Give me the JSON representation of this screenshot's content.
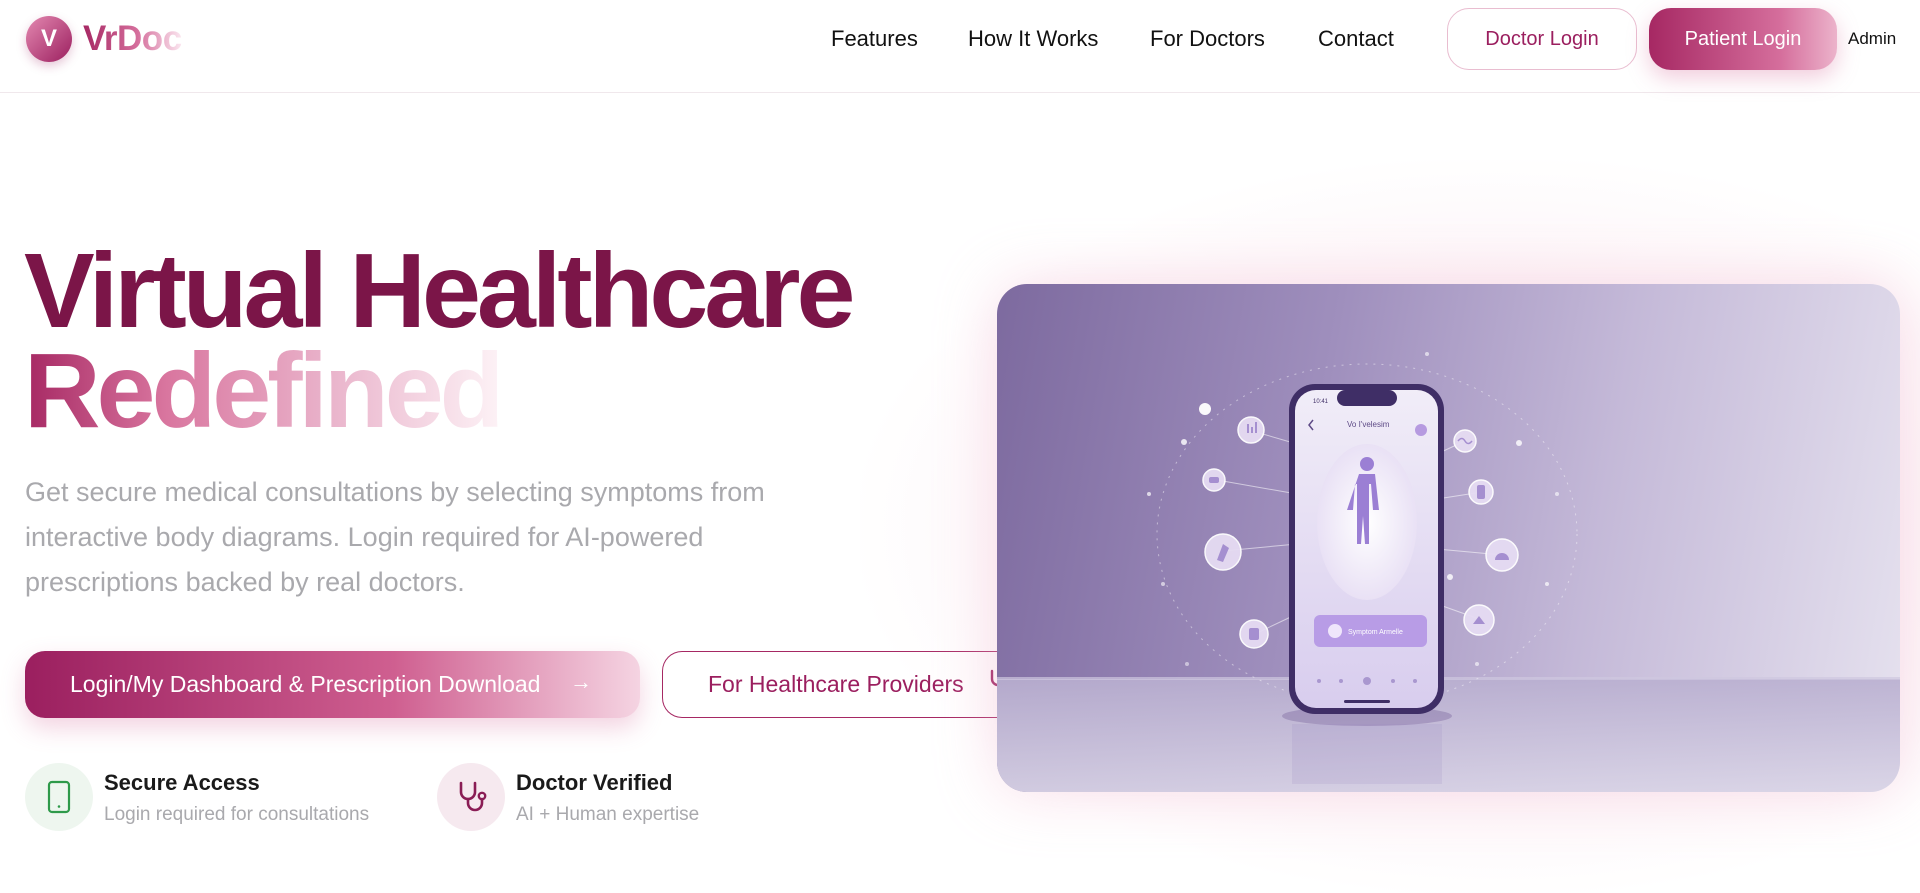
{
  "brand": {
    "logo_letter": "V",
    "name": "VrDoc"
  },
  "nav": {
    "items": [
      {
        "label": "Features"
      },
      {
        "label": "How It Works"
      },
      {
        "label": "For Doctors"
      },
      {
        "label": "Contact"
      }
    ],
    "doctor_login": "Doctor Login",
    "patient_login": "Patient Login",
    "admin": "Admin"
  },
  "hero": {
    "title_line1": "Virtual Healthcare",
    "title_line2": "Redefined",
    "description": "Get secure medical consultations by selecting symptoms from interactive body diagrams. Login required for AI-powered prescriptions backed by real doctors.",
    "primary_cta": "Login/My Dashboard & Prescription Download",
    "secondary_cta": "For Healthcare Providers"
  },
  "features": [
    {
      "title": "Secure Access",
      "subtitle": "Login required for consultations",
      "icon": "smartphone-icon"
    },
    {
      "title": "Doctor Verified",
      "subtitle": "AI + Human expertise",
      "icon": "stethoscope-icon"
    }
  ],
  "illustration": {
    "phone_time": "10:41",
    "phone_header": "Vo I'velesim",
    "phone_button": "Symptom Armelle"
  },
  "colors": {
    "primary": "#9b1f5f",
    "primary_dark": "#7b1548",
    "accent_pink": "#d56e9c",
    "muted_text": "#a9a9ad",
    "success_green": "#2e9a4a"
  }
}
